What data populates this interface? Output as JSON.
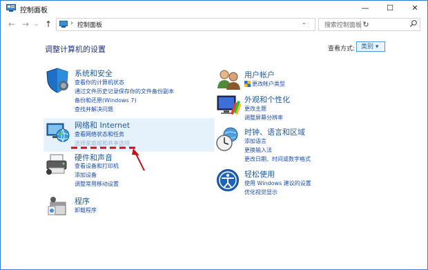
{
  "window": {
    "title": "控制面板",
    "controls": {
      "minimize": "—",
      "maximize": "☐",
      "close": "✕"
    }
  },
  "address": {
    "back": "←",
    "forward": "→",
    "recent": "⌄",
    "up": "↑",
    "separator": "›",
    "path": "控制面板",
    "dropdown": "⌄",
    "refresh": "↻",
    "search_placeholder": "搜索控制面板"
  },
  "header": {
    "title": "调整计算机的设置",
    "view_label": "查看方式:",
    "view_value": "类别 ▾"
  },
  "categories": {
    "system": {
      "title": "系统和安全",
      "links": [
        "查看你的计算机状态",
        "通过文件历史记录保存你的文件备份副本",
        "备份和还原(Windows 7)",
        "查找并解决问题"
      ]
    },
    "network": {
      "title": "网络和 Internet",
      "links": [
        "查看网络状态和任务",
        "选择家庭组和共享选项"
      ]
    },
    "hardware": {
      "title": "硬件和声音",
      "links": [
        "查看设备和打印机",
        "添加设备",
        "调整常用移动设置"
      ]
    },
    "programs": {
      "title": "程序",
      "links": [
        "卸载程序"
      ]
    },
    "users": {
      "title": "用户帐户",
      "links": [
        "更改帐户类型"
      ]
    },
    "appearance": {
      "title": "外观和个性化",
      "links": [
        "更改主题",
        "调整屏幕分辨率"
      ]
    },
    "clock": {
      "title": "时钟、语言和区域",
      "links": [
        "添加语言",
        "更换输入法",
        "更改日期、时间或数字格式"
      ]
    },
    "ease": {
      "title": "轻松使用",
      "links": [
        "使用 Windows 建议的设置",
        "优化视觉显示"
      ]
    }
  },
  "annotation_color": "#c0141c"
}
